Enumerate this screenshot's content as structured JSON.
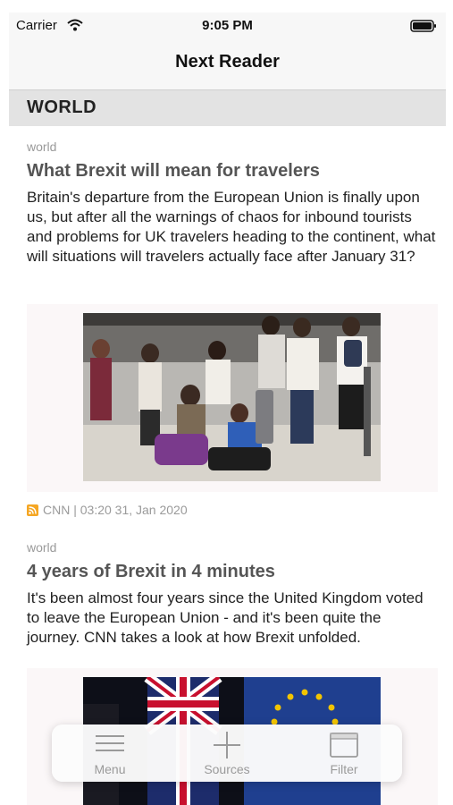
{
  "status_bar": {
    "carrier": "Carrier",
    "time": "9:05 PM"
  },
  "nav": {
    "title": "Next Reader"
  },
  "section": {
    "title": "WORLD"
  },
  "articles": [
    {
      "category": "world",
      "headline": "What Brexit will mean for travelers",
      "summary": "Britain's departure from the European Union is finally upon us, but after all the warnings of chaos for inbound tourists and problems for UK travelers heading to the continent, what will situations will travelers actually face after January 31?",
      "source": "CNN | 03:20 31, Jan 2020"
    },
    {
      "category": "world",
      "headline": "4 years of Brexit in 4 minutes",
      "summary": "It's been almost four years since the United Kingdom voted to leave the European Union - and it's been quite the journey. CNN takes a look at how Brexit unfolded."
    }
  ],
  "tab_bar": {
    "items": [
      {
        "label": "Menu",
        "icon": "menu-icon"
      },
      {
        "label": "Sources",
        "icon": "plus-icon"
      },
      {
        "label": "Filter",
        "icon": "filter-icon"
      }
    ]
  },
  "colors": {
    "rss": "#f5a623",
    "eu_blue": "#1f3f8f",
    "eu_star": "#f2c400"
  }
}
